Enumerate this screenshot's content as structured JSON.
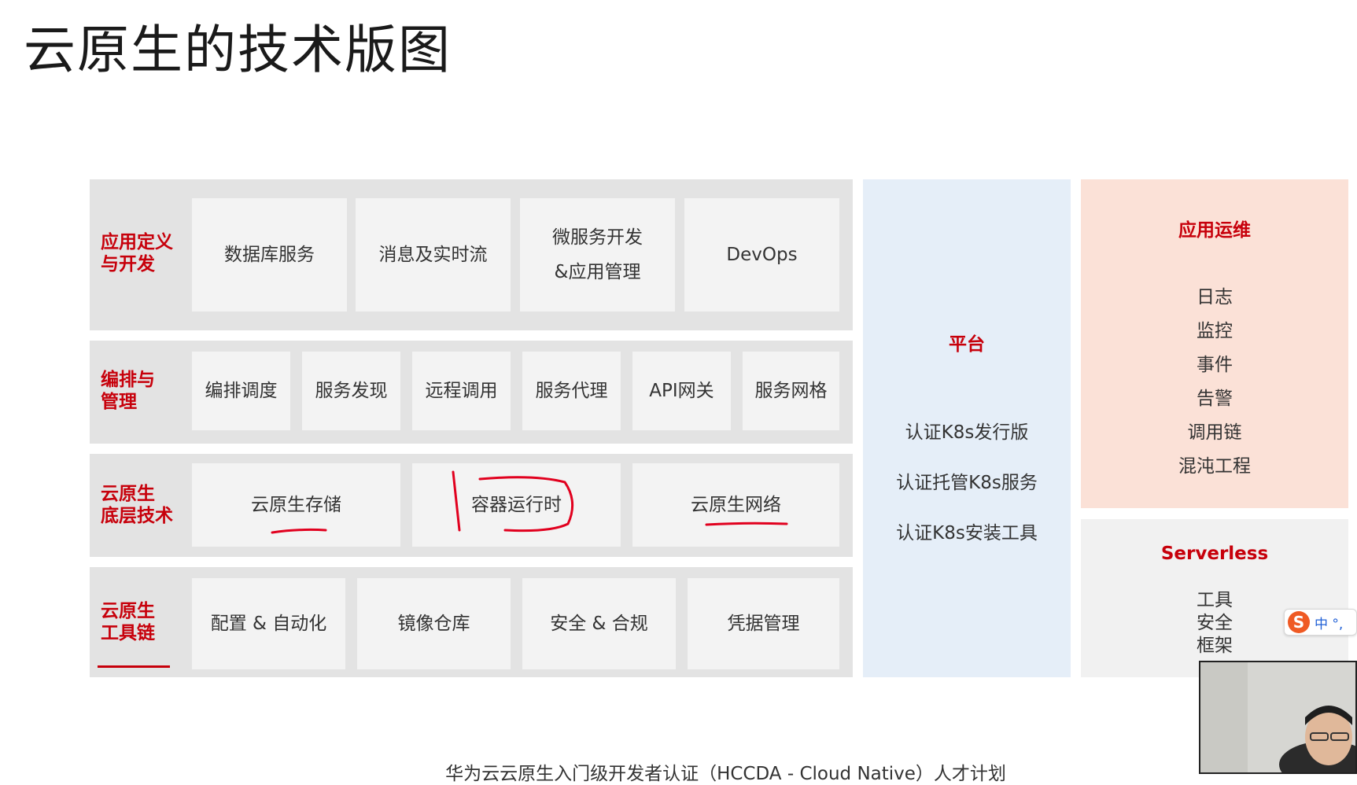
{
  "title": "云原生的技术版图",
  "rows": {
    "app_dev": {
      "label_line1": "应用定义",
      "label_line2": "与开发",
      "cells": {
        "c1": "数据库服务",
        "c2": "消息及实时流",
        "c3_line1": "微服务开发",
        "c3_line2": "&应用管理",
        "c4": "DevOps"
      }
    },
    "orchestration": {
      "label_line1": "编排与",
      "label_line2": "管理",
      "cells": [
        "编排调度",
        "服务发现",
        "远程调用",
        "服务代理",
        "API网关",
        "服务网格"
      ]
    },
    "infra": {
      "label_line1": "云原生",
      "label_line2": "底层技术",
      "cells": [
        "云原生存储",
        "容器运行时",
        "云原生网络"
      ]
    },
    "toolchain": {
      "label_line1": "云原生",
      "label_line2": "工具链",
      "cells": [
        "配置 & 自动化",
        "镜像仓库",
        "安全 & 合规",
        "凭据管理"
      ]
    }
  },
  "platform": {
    "title": "平台",
    "items": [
      "认证K8s发行版",
      "认证托管K8s服务",
      "认证K8s安装工具"
    ]
  },
  "ops": {
    "title": "应用运维",
    "items": [
      "日志",
      "监控",
      "事件",
      "告警",
      "调用链",
      "混沌工程"
    ]
  },
  "serverless": {
    "title": "Serverless",
    "items": [
      "工具",
      "安全",
      "框架"
    ]
  },
  "ime": {
    "logo": "S",
    "text": "中 °,"
  },
  "footer": "华为云云原生入门级开发者认证（HCCDA - Cloud Native）人才计划",
  "colors": {
    "accent": "#c7000b",
    "row_bg": "#e3e3e3",
    "cell_bg": "#f3f3f3",
    "platform_bg": "#e5eef8",
    "ops_bg": "#fbe1d7",
    "serverless_bg": "#f1f1f1"
  }
}
